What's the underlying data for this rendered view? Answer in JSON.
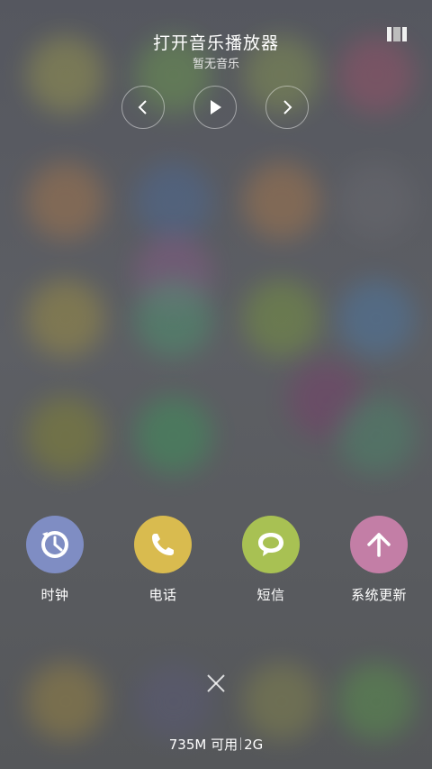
{
  "music_player": {
    "title": "打开音乐播放器",
    "subtitle": "暂无音乐",
    "controls": {
      "previous_icon": "chevron-left-icon",
      "play_icon": "play-icon",
      "next_icon": "chevron-right-icon"
    },
    "layout_toggle_icon": "columns-icon"
  },
  "shortcuts": [
    {
      "label": "时钟",
      "icon": "clock-icon",
      "color": "#7f8dc3"
    },
    {
      "label": "电话",
      "icon": "phone-icon",
      "color": "#d9bb4f"
    },
    {
      "label": "短信",
      "icon": "message-icon",
      "color": "#a8c153"
    },
    {
      "label": "系统更新",
      "icon": "arrow-up-icon",
      "color": "#c37ea6"
    }
  ],
  "close": {
    "icon": "close-icon"
  },
  "memory": {
    "available": "735M 可用",
    "network": "2G"
  }
}
